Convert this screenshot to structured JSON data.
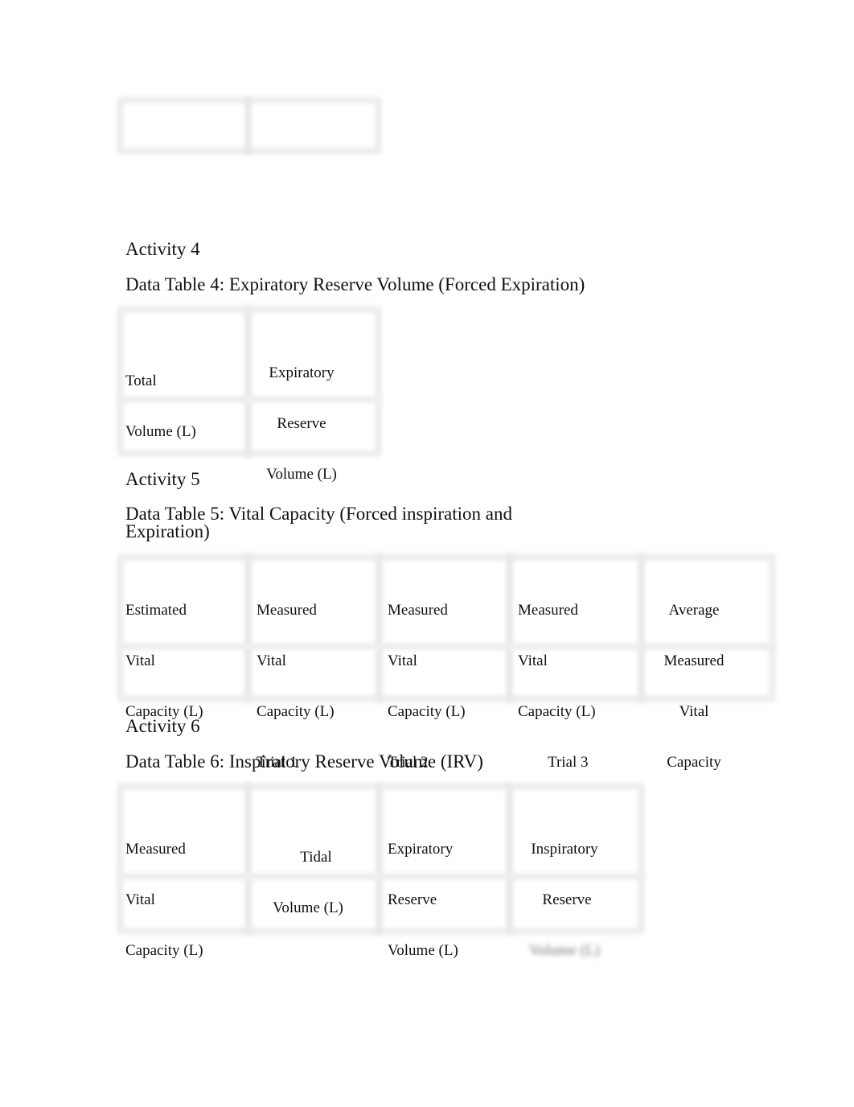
{
  "table_top": {
    "columns": [
      "",
      ""
    ],
    "rows": [
      [
        "",
        ""
      ]
    ]
  },
  "activity4": {
    "heading": "Activity 4",
    "table_title": "Data Table 4: Expiratory Reserve Volume (Forced Expiration)",
    "headers": [
      [
        "Total",
        "Volume (L)"
      ],
      [
        "Expiratory",
        "Reserve",
        "Volume (L)"
      ]
    ],
    "rows": [
      [
        "",
        ""
      ]
    ]
  },
  "activity5": {
    "heading": "Activity 5",
    "table_title_line1": "Data Table 5: Vital Capacity (Forced inspiration and",
    "table_title_line2": "Expiration)",
    "headers": [
      [
        "Estimated",
        "Vital",
        "Capacity (L)"
      ],
      [
        "Measured",
        "Vital",
        "Capacity (L)",
        "Trial 1"
      ],
      [
        "Measured",
        "Vital",
        "Capacity (L)",
        "Trial 2"
      ],
      [
        "Measured",
        "Vital",
        "Capacity (L)",
        "Trial 3"
      ],
      [
        "Average",
        "Measured",
        "Vital",
        "Capacity"
      ]
    ],
    "rows": [
      [
        "",
        "",
        "",
        "",
        ""
      ]
    ]
  },
  "activity6": {
    "heading": "Activity 6",
    "table_title": "Data Table 6: Inspiratory Reserve Volume (IRV)",
    "headers": [
      [
        "Measured",
        "Vital",
        "Capacity (L)"
      ],
      [
        "Tidal",
        "Volume (L)"
      ],
      [
        "Expiratory",
        "Reserve",
        "Volume (L)"
      ],
      [
        "Inspiratory",
        "Reserve",
        "Volume (L)"
      ]
    ],
    "rows": [
      [
        "",
        "",
        "",
        ""
      ]
    ]
  }
}
